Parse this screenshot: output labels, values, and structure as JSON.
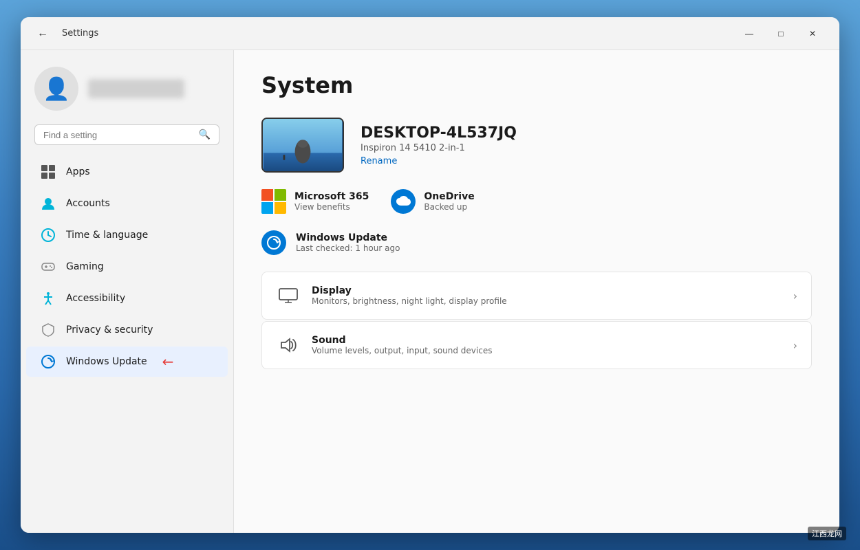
{
  "titlebar": {
    "title": "Settings",
    "back_label": "←",
    "minimize_label": "—",
    "maximize_label": "□",
    "close_label": "✕"
  },
  "sidebar": {
    "search_placeholder": "Find a setting",
    "nav_items": [
      {
        "id": "apps",
        "label": "Apps",
        "icon": "apps"
      },
      {
        "id": "accounts",
        "label": "Accounts",
        "icon": "accounts"
      },
      {
        "id": "time-language",
        "label": "Time & language",
        "icon": "time"
      },
      {
        "id": "gaming",
        "label": "Gaming",
        "icon": "gaming"
      },
      {
        "id": "accessibility",
        "label": "Accessibility",
        "icon": "accessibility"
      },
      {
        "id": "privacy-security",
        "label": "Privacy & security",
        "icon": "privacy"
      },
      {
        "id": "windows-update",
        "label": "Windows Update",
        "icon": "update",
        "highlighted": true
      }
    ]
  },
  "main": {
    "page_title": "System",
    "device": {
      "name": "DESKTOP-4L537JQ",
      "model": "Inspiron 14 5410 2-in-1",
      "rename_label": "Rename"
    },
    "quick_actions": [
      {
        "id": "microsoft-365",
        "title": "Microsoft 365",
        "subtitle": "View benefits",
        "icon_type": "ms365"
      },
      {
        "id": "onedrive",
        "title": "OneDrive",
        "subtitle": "Backed up",
        "icon_type": "onedrive"
      }
    ],
    "windows_update": {
      "title": "Windows Update",
      "subtitle": "Last checked: 1 hour ago",
      "icon_type": "update"
    },
    "settings_items": [
      {
        "id": "display",
        "title": "Display",
        "subtitle": "Monitors, brightness, night light, display profile",
        "icon": "🖥"
      },
      {
        "id": "sound",
        "title": "Sound",
        "subtitle": "Volume levels, output, input, sound devices",
        "icon": "🔊"
      }
    ]
  },
  "watermark": "江西龙网"
}
